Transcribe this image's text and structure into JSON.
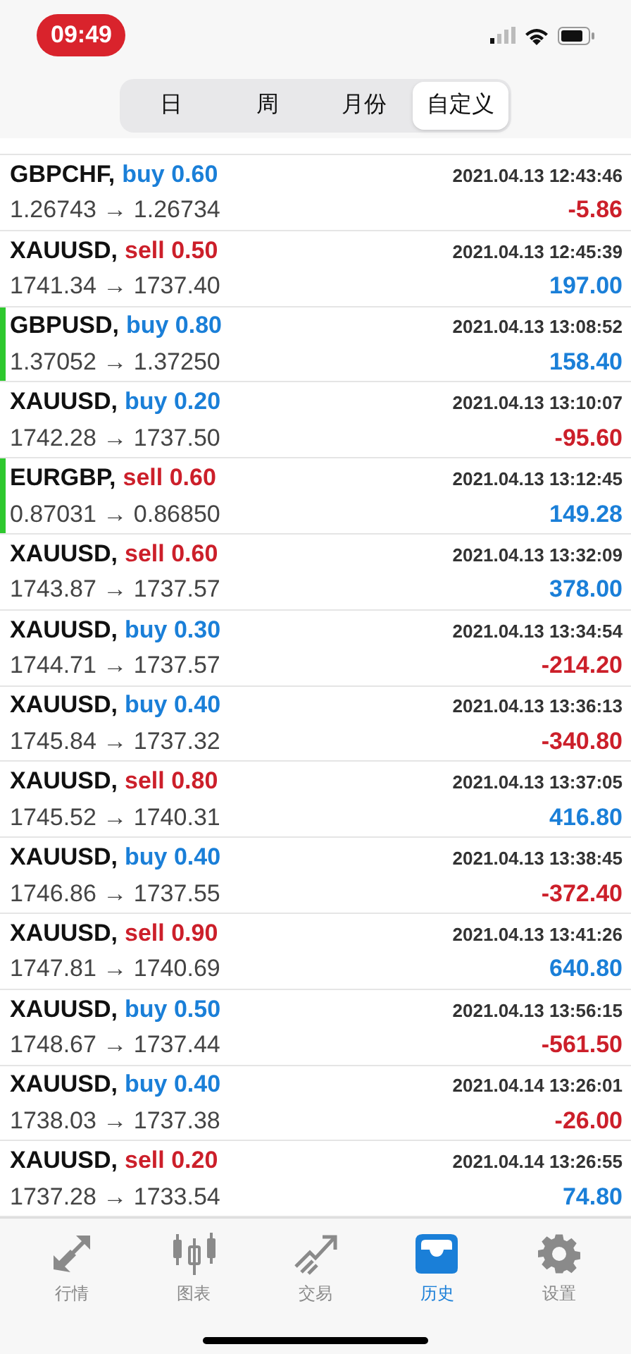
{
  "status_bar": {
    "time": "09:49"
  },
  "segments": [
    {
      "label": "日",
      "selected": false
    },
    {
      "label": "周",
      "selected": false
    },
    {
      "label": "月份",
      "selected": false
    },
    {
      "label": "自定义",
      "selected": true
    }
  ],
  "trades": [
    {
      "symbol": "GBPCHF,",
      "order": {
        "text": "buy 0.60",
        "color": "#1a7fd8"
      },
      "time": "2021.04.13 12:43:46",
      "prices": "1.26743 → 1.26734",
      "profit": {
        "text": "-5.86",
        "color": "#cc1f2a"
      },
      "flagged": false
    },
    {
      "symbol": "XAUUSD,",
      "order": {
        "text": "sell 0.50",
        "color": "#cc1f2a"
      },
      "time": "2021.04.13 12:45:39",
      "prices": "1741.34 → 1737.40",
      "profit": {
        "text": "197.00",
        "color": "#1a7fd8"
      },
      "flagged": false
    },
    {
      "symbol": "GBPUSD,",
      "order": {
        "text": "buy 0.80",
        "color": "#1a7fd8"
      },
      "time": "2021.04.13 13:08:52",
      "prices": "1.37052 → 1.37250",
      "profit": {
        "text": "158.40",
        "color": "#1a7fd8"
      },
      "flagged": true
    },
    {
      "symbol": "XAUUSD,",
      "order": {
        "text": "buy 0.20",
        "color": "#1a7fd8"
      },
      "time": "2021.04.13 13:10:07",
      "prices": "1742.28 → 1737.50",
      "profit": {
        "text": "-95.60",
        "color": "#cc1f2a"
      },
      "flagged": false
    },
    {
      "symbol": "EURGBP,",
      "order": {
        "text": "sell 0.60",
        "color": "#cc1f2a"
      },
      "time": "2021.04.13 13:12:45",
      "prices": "0.87031 → 0.86850",
      "profit": {
        "text": "149.28",
        "color": "#1a7fd8"
      },
      "flagged": true
    },
    {
      "symbol": "XAUUSD,",
      "order": {
        "text": "sell 0.60",
        "color": "#cc1f2a"
      },
      "time": "2021.04.13 13:32:09",
      "prices": "1743.87 → 1737.57",
      "profit": {
        "text": "378.00",
        "color": "#1a7fd8"
      },
      "flagged": false
    },
    {
      "symbol": "XAUUSD,",
      "order": {
        "text": "buy 0.30",
        "color": "#1a7fd8"
      },
      "time": "2021.04.13 13:34:54",
      "prices": "1744.71 → 1737.57",
      "profit": {
        "text": "-214.20",
        "color": "#cc1f2a"
      },
      "flagged": false
    },
    {
      "symbol": "XAUUSD,",
      "order": {
        "text": "buy 0.40",
        "color": "#1a7fd8"
      },
      "time": "2021.04.13 13:36:13",
      "prices": "1745.84 → 1737.32",
      "profit": {
        "text": "-340.80",
        "color": "#cc1f2a"
      },
      "flagged": false
    },
    {
      "symbol": "XAUUSD,",
      "order": {
        "text": "sell 0.80",
        "color": "#cc1f2a"
      },
      "time": "2021.04.13 13:37:05",
      "prices": "1745.52 → 1740.31",
      "profit": {
        "text": "416.80",
        "color": "#1a7fd8"
      },
      "flagged": false
    },
    {
      "symbol": "XAUUSD,",
      "order": {
        "text": "buy 0.40",
        "color": "#1a7fd8"
      },
      "time": "2021.04.13 13:38:45",
      "prices": "1746.86 → 1737.55",
      "profit": {
        "text": "-372.40",
        "color": "#cc1f2a"
      },
      "flagged": false
    },
    {
      "symbol": "XAUUSD,",
      "order": {
        "text": "sell 0.90",
        "color": "#cc1f2a"
      },
      "time": "2021.04.13 13:41:26",
      "prices": "1747.81 → 1740.69",
      "profit": {
        "text": "640.80",
        "color": "#1a7fd8"
      },
      "flagged": false
    },
    {
      "symbol": "XAUUSD,",
      "order": {
        "text": "buy 0.50",
        "color": "#1a7fd8"
      },
      "time": "2021.04.13 13:56:15",
      "prices": "1748.67 → 1737.44",
      "profit": {
        "text": "-561.50",
        "color": "#cc1f2a"
      },
      "flagged": false
    },
    {
      "symbol": "XAUUSD,",
      "order": {
        "text": "buy 0.40",
        "color": "#1a7fd8"
      },
      "time": "2021.04.14 13:26:01",
      "prices": "1738.03 → 1737.38",
      "profit": {
        "text": "-26.00",
        "color": "#cc1f2a"
      },
      "flagged": false
    },
    {
      "symbol": "XAUUSD,",
      "order": {
        "text": "sell 0.20",
        "color": "#cc1f2a"
      },
      "time": "2021.04.14 13:26:55",
      "prices": "1737.28 → 1733.54",
      "profit": {
        "text": "74.80",
        "color": "#1a7fd8"
      },
      "flagged": false
    }
  ],
  "tab_bar": [
    {
      "label": "行情",
      "selected": false
    },
    {
      "label": "图表",
      "selected": false
    },
    {
      "label": "交易",
      "selected": false
    },
    {
      "label": "历史",
      "selected": true
    },
    {
      "label": "设置",
      "selected": false
    }
  ]
}
